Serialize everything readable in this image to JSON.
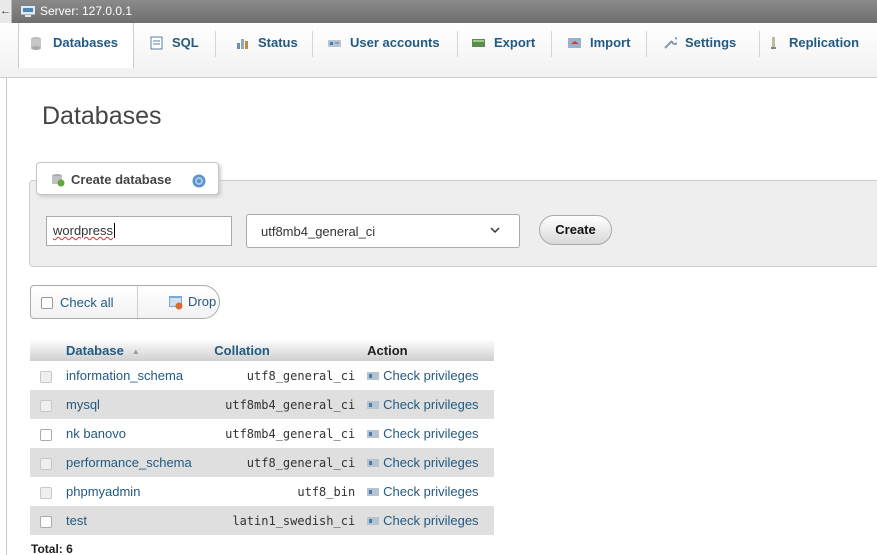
{
  "server_bar": {
    "back_glyph": "←",
    "label": "Server: 127.0.0.1"
  },
  "tabs": [
    {
      "label": "Databases",
      "icon": "database-icon"
    },
    {
      "label": "SQL",
      "icon": "sql-icon"
    },
    {
      "label": "Status",
      "icon": "status-icon"
    },
    {
      "label": "User accounts",
      "icon": "user-accounts-icon"
    },
    {
      "label": "Export",
      "icon": "export-icon"
    },
    {
      "label": "Import",
      "icon": "import-icon"
    },
    {
      "label": "Settings",
      "icon": "settings-icon"
    },
    {
      "label": "Replication",
      "icon": "replication-icon"
    }
  ],
  "page_title": "Databases",
  "create_db": {
    "legend": "Create database",
    "name_value": "wordpress",
    "collation_value": "utf8mb4_general_ci",
    "create_label": "Create"
  },
  "bulk": {
    "check_all": "Check all",
    "drop": "Drop"
  },
  "table": {
    "headers": {
      "database": "Database",
      "collation": "Collation",
      "action": "Action"
    },
    "rows": [
      {
        "name": "information_schema",
        "collation": "utf8_general_ci",
        "action": "Check privileges"
      },
      {
        "name": "mysql",
        "collation": "utf8mb4_general_ci",
        "action": "Check privileges"
      },
      {
        "name": "nk banovo",
        "collation": "utf8mb4_general_ci",
        "action": "Check privileges"
      },
      {
        "name": "performance_schema",
        "collation": "utf8_general_ci",
        "action": "Check privileges"
      },
      {
        "name": "phpmyadmin",
        "collation": "utf8_bin",
        "action": "Check privileges"
      },
      {
        "name": "test",
        "collation": "latin1_swedish_ci",
        "action": "Check privileges"
      }
    ]
  },
  "total": "Total: 6",
  "colors": {
    "link": "#235a81",
    "row_alt": "#dfdfdf",
    "server_bar": "#7a7a7a"
  }
}
